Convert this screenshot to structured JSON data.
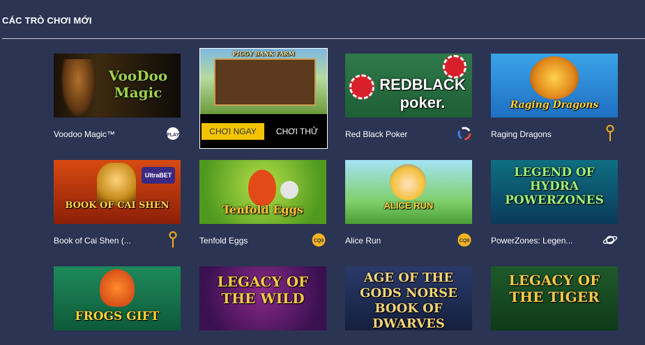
{
  "section": {
    "title": "CÁC TRÒ CHƠI MỚI"
  },
  "hover_card": {
    "play_label": "CHƠI NGAY",
    "demo_label": "CHƠI THỬ",
    "thumb_text": "PIGGY BANK FARM"
  },
  "games": [
    {
      "name": "Voodoo Magic™",
      "thumb_text": "VooDoo Magic",
      "provider_icon": "play-n-go-icon"
    },
    {
      "name": "",
      "thumb_text": "",
      "provider_icon": ""
    },
    {
      "name": "Red Black Poker",
      "thumb_text": "REDBLACK poker.",
      "provider_icon": "swirl-logo-icon"
    },
    {
      "name": "Raging Dragons",
      "thumb_text": "Raging Dragons",
      "provider_icon": "pin-logo-icon"
    },
    {
      "name": "Book of Cai Shen (...",
      "thumb_text": "BOOK OF CAI SHEN",
      "provider_icon": "pin-logo-icon"
    },
    {
      "name": "Tenfold Eggs",
      "thumb_text": "Tenfold Eggs",
      "provider_icon": "cq9-logo-icon"
    },
    {
      "name": "Alice Run",
      "thumb_text": "ALICE RUN",
      "provider_icon": "cq9-logo-icon"
    },
    {
      "name": "PowerZones: Legen...",
      "thumb_text": "LEGEND OF HYDRA POWERZONES",
      "provider_icon": "planet-logo-icon"
    },
    {
      "name": "",
      "thumb_text": "FROGS GIFT",
      "provider_icon": ""
    },
    {
      "name": "",
      "thumb_text": "LEGACY OF THE WILD",
      "provider_icon": ""
    },
    {
      "name": "",
      "thumb_text": "AGE OF THE GODS NORSE BOOK OF DWARVES",
      "provider_icon": ""
    },
    {
      "name": "",
      "thumb_text": "LEGACY OF THE TIGER",
      "provider_icon": ""
    }
  ]
}
